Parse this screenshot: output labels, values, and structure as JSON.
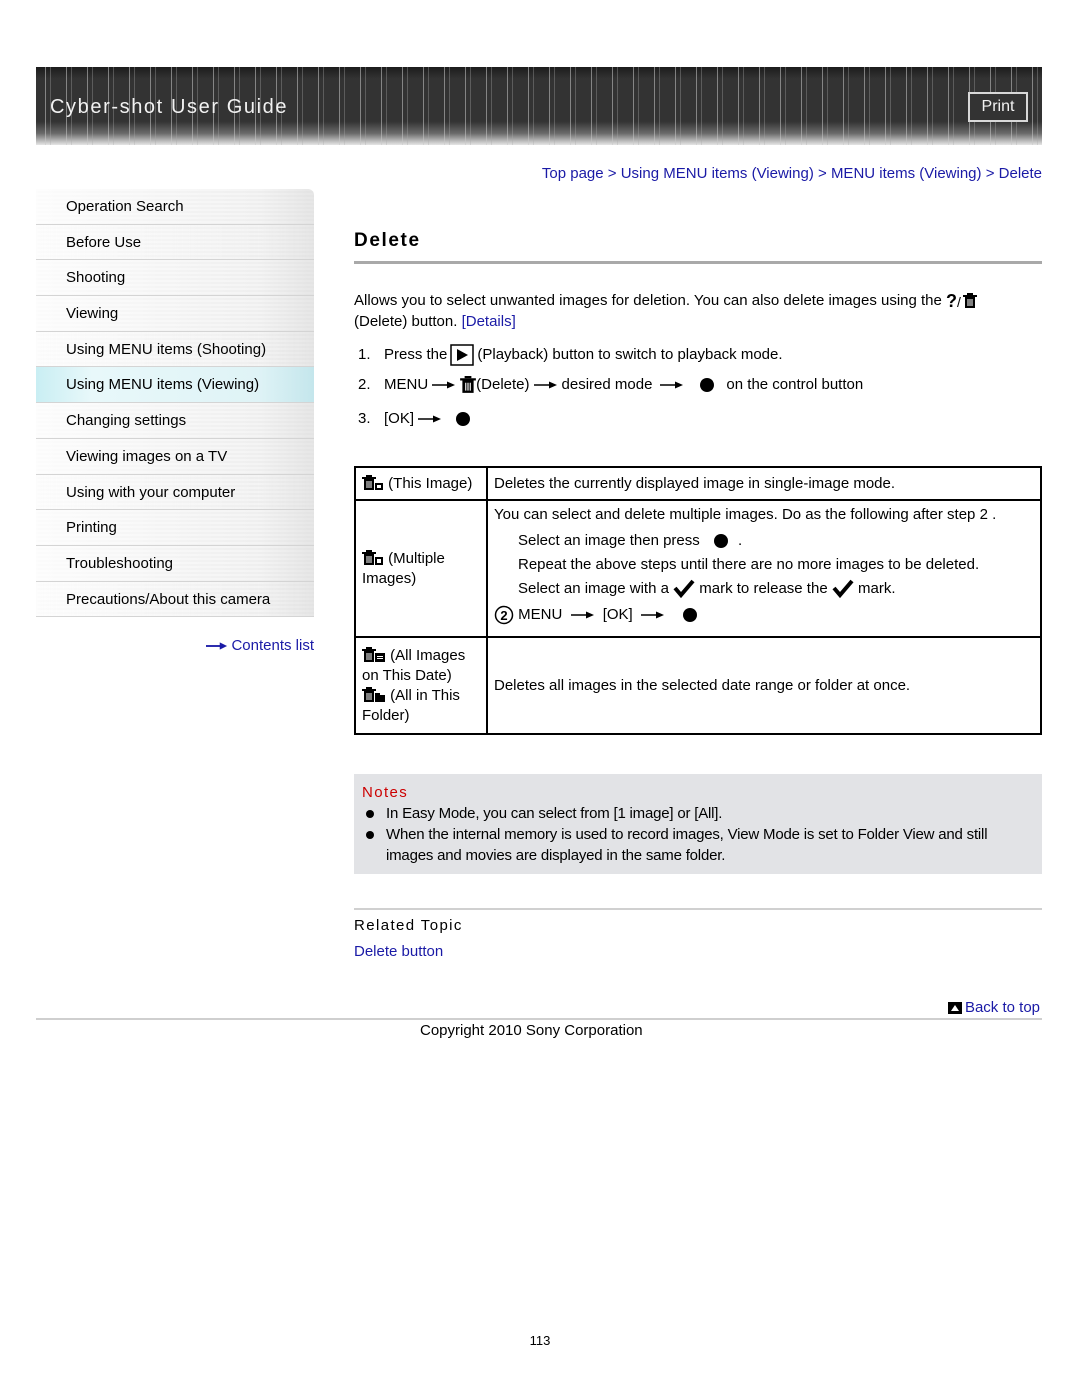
{
  "header": {
    "title": "Cyber-shot User Guide",
    "print_label": "Print"
  },
  "sidebar": {
    "items": [
      {
        "label": "Operation Search",
        "active": false
      },
      {
        "label": "Before Use",
        "active": false
      },
      {
        "label": "Shooting",
        "active": false
      },
      {
        "label": "Viewing",
        "active": false
      },
      {
        "label": "Using MENU items (Shooting)",
        "active": false
      },
      {
        "label": "Using MENU items (Viewing)",
        "active": true
      },
      {
        "label": "Changing settings",
        "active": false
      },
      {
        "label": "Viewing images on a TV",
        "active": false
      },
      {
        "label": "Using with your computer",
        "active": false
      },
      {
        "label": "Printing",
        "active": false
      },
      {
        "label": "Troubleshooting",
        "active": false
      },
      {
        "label": "Precautions/About this camera",
        "active": false
      }
    ],
    "contents_link": "Contents list"
  },
  "breadcrumb": {
    "items": [
      "Top page",
      "Using MENU items (Viewing)",
      "MENU items (Viewing)",
      "Delete"
    ],
    "separator": ">"
  },
  "main": {
    "title": "Delete",
    "intro_1": "Allows you to select unwanted images for deletion. You can also delete images using the",
    "intro_2": "(Delete) button.",
    "details_link": "[Details]",
    "steps": [
      {
        "num": "1.",
        "a": "Press the",
        "b": "(Playback) button to switch to playback mode."
      },
      {
        "num": "2.",
        "a": "MENU",
        "b": "(Delete)",
        "c": "desired mode",
        "d": "on the control button"
      },
      {
        "num": "3.",
        "a": "[OK]"
      }
    ]
  },
  "table": {
    "rows": [
      {
        "mode": "(This Image)",
        "desc": "Deletes the currently displayed image in single-image mode."
      },
      {
        "mode": "(Multiple Images)",
        "desc": "You can select and delete multiple images. Do as the following after step 2 .",
        "sub_1": "Select an image then press",
        "sub_1_end": ".",
        "sub_2": "Repeat the above steps until there are no more images to be deleted.",
        "sub_3a": "Select an image with a",
        "sub_3b": "mark to release the",
        "sub_3c": "mark.",
        "sub_4a": "MENU",
        "sub_4b": "[OK]"
      },
      {
        "mode_a": "(All Images on This Date)",
        "mode_b": "(All in This Folder)",
        "desc": "Deletes all images in the selected date range or folder at once."
      }
    ]
  },
  "notes": {
    "title": "Notes",
    "items": [
      "In Easy Mode, you can select from [1 image] or [All].",
      "When the internal memory is used to record images, View Mode is set to Folder View and still images and movies are displayed in the same folder."
    ]
  },
  "related": {
    "title": "Related Topic",
    "link": "Delete button"
  },
  "footer": {
    "back_to_top": "Back to top",
    "copyright": "Copyright 2010 Sony Corporation",
    "page_number": "113"
  },
  "colors": {
    "link": "#1a1aa6",
    "notes_title": "#cc0000",
    "notes_bg": "#e2e3e6",
    "active_nav": "#d6f2f6"
  }
}
